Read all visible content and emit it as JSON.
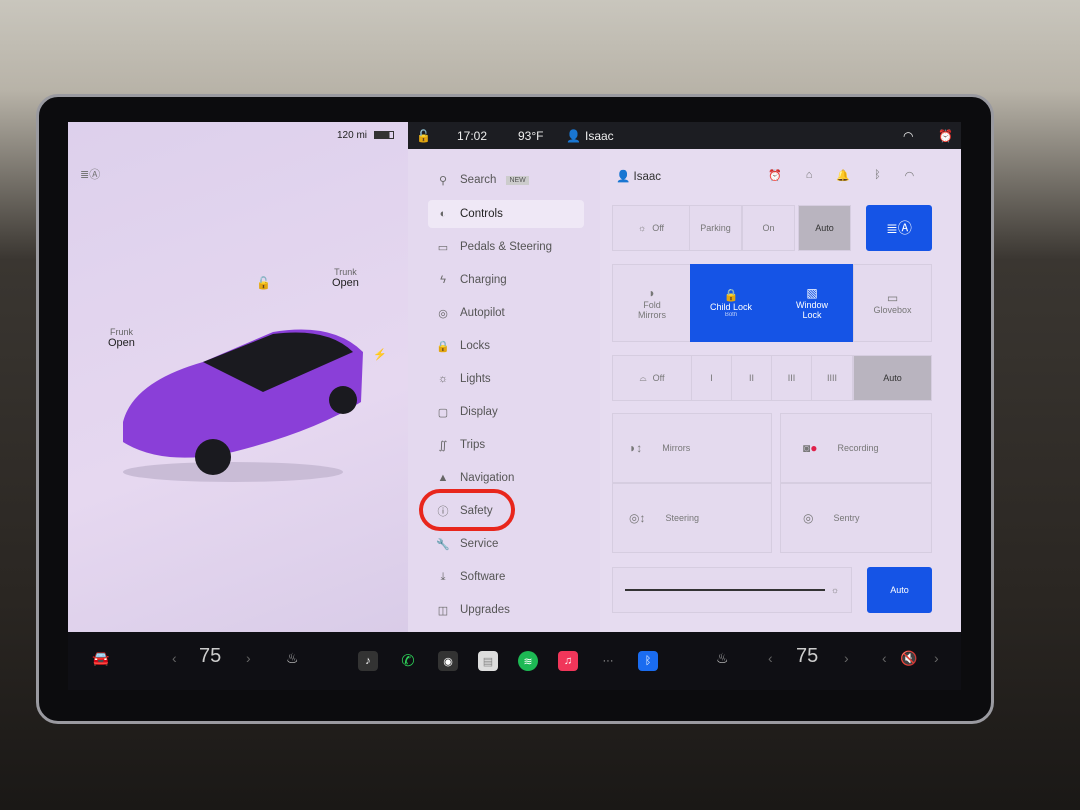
{
  "status": {
    "time": "17:02",
    "temp": "93°F",
    "user": "Isaac",
    "range": "120 mi"
  },
  "car": {
    "frunk_label": "Frunk",
    "frunk_state": "Open",
    "trunk_label": "Trunk",
    "trunk_state": "Open"
  },
  "menu": {
    "search": "Search",
    "search_badge": "NEW",
    "items": [
      {
        "label": "Controls",
        "icon": "toggle-icon",
        "active": true
      },
      {
        "label": "Pedals & Steering",
        "icon": "car-icon"
      },
      {
        "label": "Charging",
        "icon": "bolt-icon"
      },
      {
        "label": "Autopilot",
        "icon": "steering-wheel-icon"
      },
      {
        "label": "Locks",
        "icon": "lock-icon"
      },
      {
        "label": "Lights",
        "icon": "sun-icon"
      },
      {
        "label": "Display",
        "icon": "display-icon"
      },
      {
        "label": "Trips",
        "icon": "trips-icon"
      },
      {
        "label": "Navigation",
        "icon": "navigation-icon"
      },
      {
        "label": "Safety",
        "icon": "info-circle-icon",
        "highlighted": true
      },
      {
        "label": "Service",
        "icon": "wrench-icon"
      },
      {
        "label": "Software",
        "icon": "download-icon"
      },
      {
        "label": "Upgrades",
        "icon": "bag-icon"
      }
    ]
  },
  "controls": {
    "profile": "Isaac",
    "lights": {
      "options": [
        "Off",
        "Parking",
        "On",
        "Auto"
      ],
      "selected": "Auto"
    },
    "tiles": {
      "fold_mirrors": "Fold Mirrors",
      "child_lock": "Child Lock",
      "child_lock_sub": "Both",
      "window_lock": "Window Lock",
      "glovebox": "Glovebox"
    },
    "wipers": {
      "options": [
        "Off",
        "I",
        "II",
        "III",
        "IIII",
        "Auto"
      ],
      "selected": "Auto"
    },
    "mirrors": "Mirrors",
    "recording": "Recording",
    "steering": "Steering",
    "sentry": "Sentry",
    "brightness_auto": "Auto"
  },
  "dock": {
    "driver_temp": "75",
    "passenger_temp": "75"
  },
  "colors": {
    "accent": "#1554e6",
    "highlight_circle": "#e8261c"
  }
}
